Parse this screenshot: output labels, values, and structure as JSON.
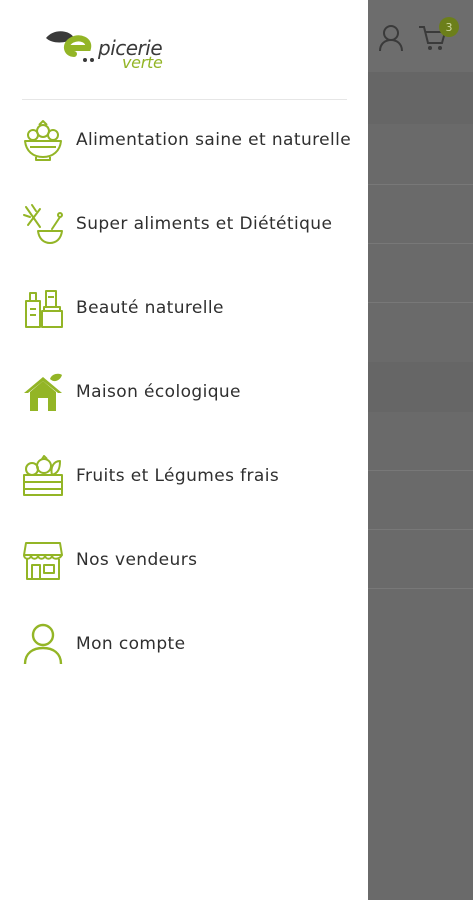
{
  "app": {
    "cart_count": "3"
  },
  "logo": {
    "line1": "picerie",
    "line2": "verte"
  },
  "menu": {
    "items": [
      {
        "label": "Alimentation saine et naturelle",
        "icon": "salad-bowl-icon"
      },
      {
        "label": "Super aliments et Diététique",
        "icon": "mortar-pestle-icon"
      },
      {
        "label": "Beauté naturelle",
        "icon": "cosmetics-icon"
      },
      {
        "label": "Maison écologique",
        "icon": "eco-house-icon"
      },
      {
        "label": "Fruits et Légumes frais",
        "icon": "produce-crate-icon"
      },
      {
        "label": "Nos vendeurs",
        "icon": "storefront-icon"
      },
      {
        "label": "Mon compte",
        "icon": "user-icon"
      }
    ]
  },
  "colors": {
    "accent": "#93b526",
    "overlay": "#6a6a6a",
    "text": "#2f2f2f"
  }
}
